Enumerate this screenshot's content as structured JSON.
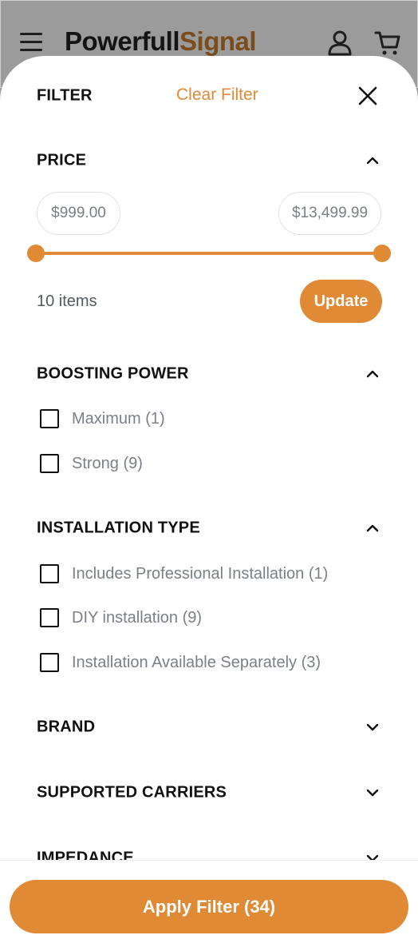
{
  "header": {
    "brand_part1": "Powerfull",
    "brand_part2": "Signal",
    "icons": [
      "hamburger-menu-icon",
      "user-icon",
      "cart-icon"
    ]
  },
  "filter": {
    "title": "FILTER",
    "clear_label": "Clear Filter",
    "close_icon": "close-icon"
  },
  "price": {
    "title": "PRICE",
    "min": "$999.00",
    "max": "$13,499.99",
    "slider_range_fraction": [
      0.0,
      1.0
    ],
    "items_text": "10 items",
    "update_label": "Update",
    "expanded": true
  },
  "boosting_power": {
    "title": "BOOSTING POWER",
    "expanded": true,
    "options": [
      {
        "label": "Maximum (1)",
        "checked": false
      },
      {
        "label": "Strong (9)",
        "checked": false
      }
    ]
  },
  "installation_type": {
    "title": "INSTALLATION TYPE",
    "expanded": true,
    "options": [
      {
        "label": "Includes Professional Installation (1)",
        "checked": false
      },
      {
        "label": "DIY installation (9)",
        "checked": false
      },
      {
        "label": "Installation Available Separately (3)",
        "checked": false
      }
    ]
  },
  "collapsed_sections": [
    {
      "title": "BRAND",
      "expanded": false
    },
    {
      "title": "SUPPORTED CARRIERS",
      "expanded": false
    },
    {
      "title": "IMPEDANCE",
      "expanded": false
    }
  ],
  "footer": {
    "apply_label": "Apply Filter (34)"
  },
  "colors": {
    "accent": "#e08a35",
    "overlay": "#9b9b9b",
    "text_dark": "#111111",
    "text_muted": "#7b7f87"
  }
}
